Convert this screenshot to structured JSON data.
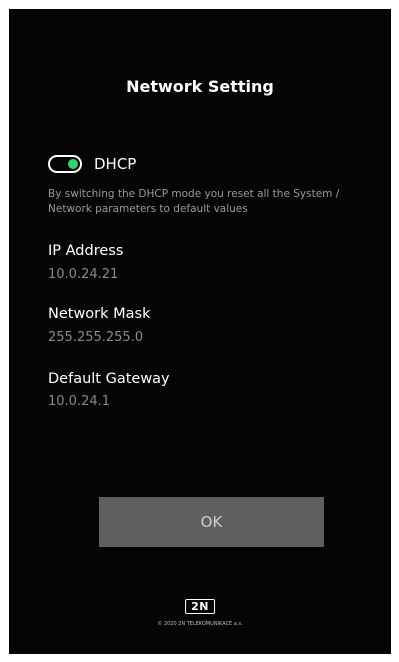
{
  "screen": {
    "title": "Network Setting"
  },
  "dhcp": {
    "label": "DHCP",
    "enabled": true,
    "toggle_color": "#2fd46b",
    "note": "By switching the DHCP mode you reset all the System / Network parameters to default values"
  },
  "fields": {
    "ip_address": {
      "label": "IP Address",
      "value": "10.0.24.21"
    },
    "network_mask": {
      "label": "Network Mask",
      "value": "255.255.255.0"
    },
    "default_gateway": {
      "label": "Default Gateway",
      "value": "10.0.24.1"
    }
  },
  "actions": {
    "ok_label": "OK"
  },
  "footer": {
    "logo_text": "2N",
    "copyright": "© 2020 2N TELEKOMUNIKACE a.s."
  },
  "colors": {
    "background": "#050505",
    "accent": "#2fd46b",
    "button": "#5f5f5f"
  }
}
